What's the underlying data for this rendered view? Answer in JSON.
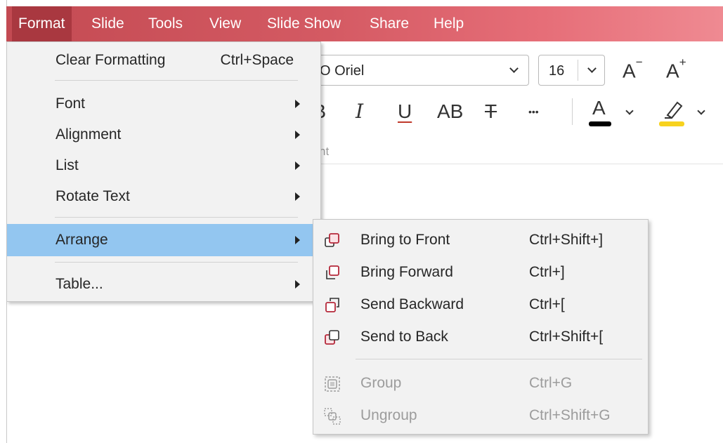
{
  "menubar": {
    "items": [
      {
        "label": "Format",
        "active": true
      },
      {
        "label": "Slide"
      },
      {
        "label": "Tools"
      },
      {
        "label": "View"
      },
      {
        "label": "Slide Show"
      },
      {
        "label": "Share"
      },
      {
        "label": "Help"
      }
    ],
    "colors": {
      "gradient_start": "#c34a52",
      "gradient_end": "#ef8a92",
      "active": "#a93840"
    }
  },
  "ribbon": {
    "font_name": "O Oriel",
    "font_size": "16",
    "decrease_font": "A",
    "decrease_mark": "−",
    "increase_font": "A",
    "increase_mark": "+",
    "bold_partial": "B",
    "italic": "I",
    "underline": "U",
    "caps": "AB",
    "strikethrough": "T",
    "more": "•••",
    "font_color_glyph": "A",
    "group_label_partial": "nt",
    "font_color": "#000000",
    "highlight_color": "#f7d21e"
  },
  "format_menu": {
    "clear_formatting": {
      "label": "Clear Formatting",
      "shortcut": "Ctrl+Space"
    },
    "font": {
      "label": "Font"
    },
    "alignment": {
      "label": "Alignment"
    },
    "list": {
      "label": "List"
    },
    "rotate_text": {
      "label": "Rotate Text"
    },
    "arrange": {
      "label": "Arrange",
      "highlighted": true
    },
    "table": {
      "label": "Table..."
    },
    "highlight_color": "#93c6f0"
  },
  "arrange_menu": {
    "bring_to_front": {
      "label": "Bring to Front",
      "shortcut": "Ctrl+Shift+]",
      "icon": "bring-to-front-icon"
    },
    "bring_forward": {
      "label": "Bring Forward",
      "shortcut": "Ctrl+]",
      "icon": "bring-forward-icon"
    },
    "send_backward": {
      "label": "Send Backward",
      "shortcut": "Ctrl+[",
      "icon": "send-backward-icon"
    },
    "send_to_back": {
      "label": "Send to Back",
      "shortcut": "Ctrl+Shift+[",
      "icon": "send-to-back-icon"
    },
    "group": {
      "label": "Group",
      "shortcut": "Ctrl+G",
      "disabled": true,
      "icon": "group-icon"
    },
    "ungroup": {
      "label": "Ungroup",
      "shortcut": "Ctrl+Shift+G",
      "disabled": true,
      "icon": "ungroup-icon"
    },
    "icon_color": "#b5283a"
  }
}
